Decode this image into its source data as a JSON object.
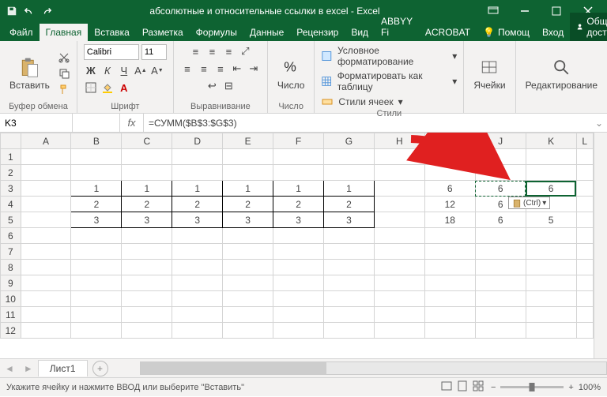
{
  "titlebar": {
    "title": "абсолютные и относительные ссылки в excel - Excel"
  },
  "tabs": {
    "items": [
      "Файл",
      "Главная",
      "Вставка",
      "Разметка",
      "Формулы",
      "Данные",
      "Рецензир",
      "Вид",
      "ABBYY Fi",
      "ACROBAT"
    ],
    "active": 1,
    "help": "Помощ",
    "login": "Вход",
    "share": "Общий доступ"
  },
  "ribbon": {
    "clipboard": {
      "paste": "Вставить",
      "label": "Буфер обмена"
    },
    "font": {
      "name": "Calibri",
      "size": "11",
      "label": "Шрифт"
    },
    "alignment": {
      "label": "Выравнивание"
    },
    "number": {
      "big": "Число",
      "label": "Число"
    },
    "styles": {
      "cond": "Условное форматирование",
      "table": "Форматировать как таблицу",
      "cell": "Стили ячеек",
      "label": "Стили"
    },
    "cells": {
      "big": "Ячейки"
    },
    "editing": {
      "big": "Редактирование"
    }
  },
  "namebox": "K3",
  "formula": "=СУММ($B$3:$G$3)",
  "columns": [
    "A",
    "B",
    "C",
    "D",
    "E",
    "F",
    "G",
    "H",
    "I",
    "J",
    "K",
    "L"
  ],
  "rows": [
    "1",
    "2",
    "3",
    "4",
    "5",
    "6",
    "7",
    "8",
    "9",
    "10",
    "11",
    "12"
  ],
  "cells": {
    "r3": {
      "B": "1",
      "C": "1",
      "D": "1",
      "E": "1",
      "F": "1",
      "G": "1",
      "I": "6",
      "J": "6",
      "K": "6"
    },
    "r4": {
      "B": "2",
      "C": "2",
      "D": "2",
      "E": "2",
      "F": "2",
      "G": "2",
      "I": "12",
      "J": "6",
      "K": ""
    },
    "r5": {
      "B": "3",
      "C": "3",
      "D": "3",
      "E": "3",
      "F": "3",
      "G": "3",
      "I": "18",
      "J": "6",
      "K": "5"
    }
  },
  "paste_tag": "(Ctrl)",
  "sheettab": "Лист1",
  "status": {
    "msg": "Укажите ячейку и нажмите ВВОД или выберите \"Вставить\"",
    "zoom": "100%"
  }
}
